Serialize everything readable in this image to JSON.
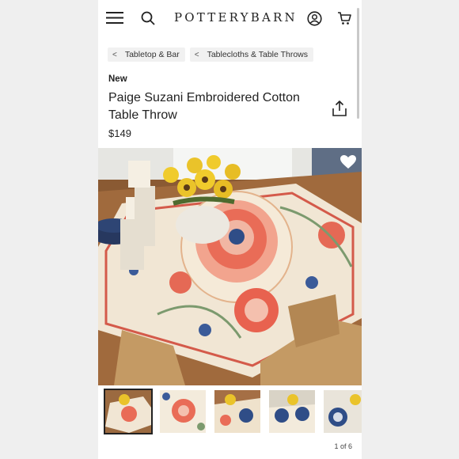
{
  "header": {
    "brand": "POTTERYBARN",
    "icons": [
      "menu-icon",
      "search-icon",
      "account-icon",
      "cart-icon"
    ]
  },
  "breadcrumbs": [
    {
      "label": "Tabletop & Bar"
    },
    {
      "label": "Tablecloths & Table Throws"
    }
  ],
  "product": {
    "badge": "New",
    "title": "Paige Suzani Embroidered Cotton Table Throw",
    "price": "$149"
  },
  "gallery": {
    "counter": "1 of 6",
    "thumbnails": 5,
    "selected_index": 0
  },
  "colors": {
    "text": "#222222",
    "crumb_bg": "#f1f1f1",
    "page_bg": "#efefef"
  }
}
